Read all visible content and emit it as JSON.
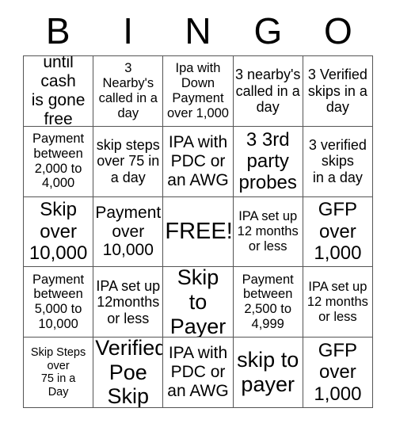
{
  "card": {
    "header": {
      "letters": [
        "B",
        "I",
        "N",
        "G",
        "O"
      ]
    },
    "rows": [
      [
        {
          "text": "until cash\nis gone\nfree",
          "size": "fs-lg"
        },
        {
          "text": "3\nNearby's\ncalled in a\nday",
          "size": "fs-sm"
        },
        {
          "text": "Ipa with\nDown\nPayment\nover 1,000",
          "size": "fs-sm"
        },
        {
          "text": "3 nearby's\ncalled in a\nday",
          "size": "fs-md"
        },
        {
          "text": "3 Verified\nskips in a\nday",
          "size": "fs-md"
        }
      ],
      [
        {
          "text": "Payment\nbetween\n2,000 to\n4,000",
          "size": "fs-sm"
        },
        {
          "text": "skip steps\nover 75 in\na day",
          "size": "fs-md"
        },
        {
          "text": "IPA with\nPDC or\nan AWG",
          "size": "fs-lg"
        },
        {
          "text": "3 3rd\nparty\nprobes",
          "size": "fs-xl"
        },
        {
          "text": "3 verified\nskips\nin a day",
          "size": "fs-md"
        }
      ],
      [
        {
          "text": "Skip\nover\n10,000",
          "size": "fs-xl"
        },
        {
          "text": "Payment\nover\n10,000",
          "size": "fs-lg"
        },
        {
          "text": "FREE!",
          "size": "fs-free"
        },
        {
          "text": "IPA set up\n12 months\nor less",
          "size": "fs-sm"
        },
        {
          "text": "GFP\nover\n1,000",
          "size": "fs-xl"
        }
      ],
      [
        {
          "text": "Payment\nbetween\n5,000 to\n10,000",
          "size": "fs-sm"
        },
        {
          "text": "IPA set up\n12months\nor less",
          "size": "fs-md"
        },
        {
          "text": "Skip\nto\nPayer",
          "size": "fs-xxl"
        },
        {
          "text": "Payment\nbetween\n2,500 to\n4,999",
          "size": "fs-sm"
        },
        {
          "text": "IPA set up\n12 months\nor less",
          "size": "fs-sm"
        }
      ],
      [
        {
          "text": "Skip Steps\nover\n75 in a\nDay",
          "size": "fs-xs"
        },
        {
          "text": "Verified\nPoe\nSkip",
          "size": "fs-xxl"
        },
        {
          "text": "IPA with\nPDC or\nan AWG",
          "size": "fs-lg"
        },
        {
          "text": "skip to\npayer",
          "size": "fs-xxl"
        },
        {
          "text": "GFP\nover\n1,000",
          "size": "fs-xl"
        }
      ]
    ]
  },
  "colors": {
    "background": "#ffffff",
    "text": "#000000",
    "grid_line": "#555555"
  }
}
